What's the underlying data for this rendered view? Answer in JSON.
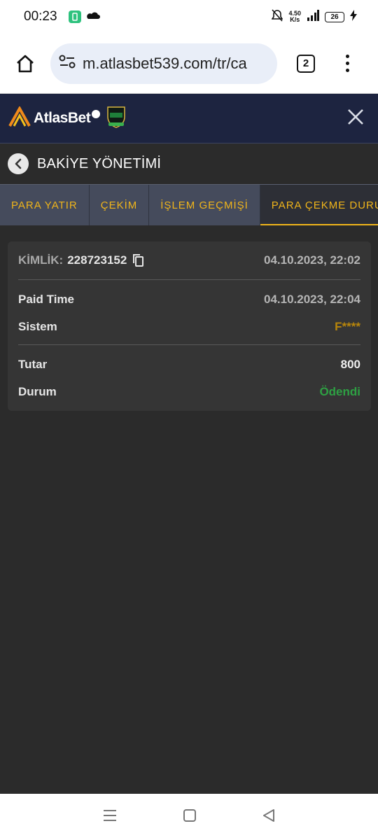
{
  "status": {
    "time": "00:23",
    "net_speed_top": "4.50",
    "net_speed_bottom": "K/s",
    "battery": "26"
  },
  "browser": {
    "url": "m.atlasbet539.com/tr/ca",
    "tab_count": "2"
  },
  "site": {
    "logo_text": "AtlasBet"
  },
  "page": {
    "title": "BAKİYE YÖNETİMİ"
  },
  "tabs": [
    {
      "label": "PARA YATIR"
    },
    {
      "label": "ÇEKİM"
    },
    {
      "label": "İŞLEM GEÇMİŞİ"
    },
    {
      "label": "PARA ÇEKME DURUMU"
    }
  ],
  "record": {
    "id_label": "KİMLİK:",
    "id_value": "228723152",
    "created": "04.10.2023, 22:02",
    "paid_time_label": "Paid Time",
    "paid_time_value": "04.10.2023, 22:04",
    "system_label": "Sistem",
    "system_value": "F****",
    "amount_label": "Tutar",
    "amount_value": "800",
    "status_label": "Durum",
    "status_value": "Ödendi"
  },
  "colors": {
    "accent": "#f0b51a",
    "success": "#2ea043",
    "header_bg": "#1d2440"
  }
}
